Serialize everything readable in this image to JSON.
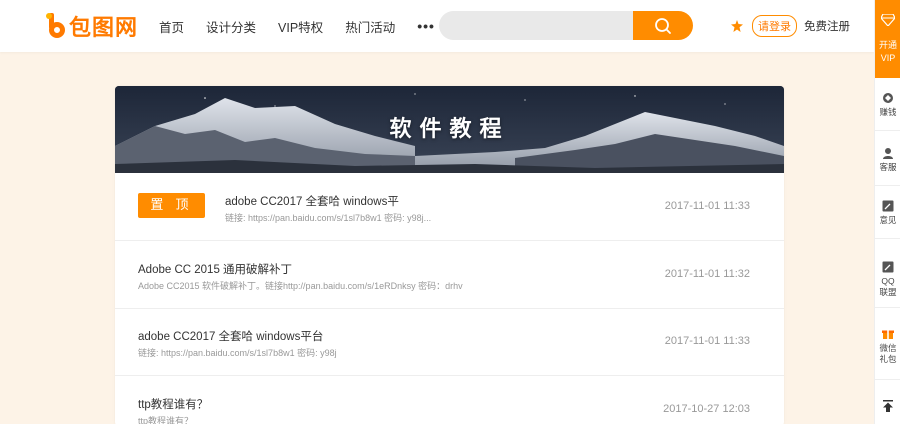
{
  "header": {
    "logo_text": "包图网",
    "nav": [
      "首页",
      "设计分类",
      "VIP特权",
      "热门活动"
    ],
    "nav_more": "•••",
    "search_placeholder": "",
    "login_label": "请登录",
    "register_label": "免费注册"
  },
  "sidebar": {
    "vip": [
      "开通",
      "VIP"
    ],
    "items": [
      {
        "icon": "ranking-icon",
        "label": [
          "赚钱"
        ]
      },
      {
        "icon": "customer-service-icon",
        "label": [
          "客服"
        ]
      },
      {
        "icon": "feedback-icon",
        "label": [
          "意见"
        ]
      },
      {
        "icon": "qq-alliance-icon",
        "label": [
          "QQ",
          "联盟"
        ]
      },
      {
        "icon": "gift-icon",
        "label": [
          "微信",
          "礼包"
        ]
      },
      {
        "icon": "back-to-top-icon",
        "label": []
      }
    ]
  },
  "banner_title": "软件教程",
  "pin_label": "置 顶",
  "articles": [
    {
      "title": "adobe CC2017 全套哈 windows平",
      "sub": "链接: https://pan.baidu.com/s/1sl7b8w1 密码: y98j...",
      "date": "2017-11-01 11:33",
      "pinned": true
    },
    {
      "title": "Adobe CC 2015 通用破解补丁",
      "sub": "Adobe CC2015 软件破解补丁。链接http://pan.baidu.com/s/1eRDnksy 密码：drhv",
      "date": "2017-11-01 11:32",
      "pinned": false
    },
    {
      "title": "adobe CC2017 全套哈 windows平台",
      "sub": "链接: https://pan.baidu.com/s/1sl7b8w1 密码: y98j",
      "date": "2017-11-01 11:33",
      "pinned": false
    },
    {
      "title": "ttp教程谁有？",
      "sub": "ttp教程谁有？",
      "date": "2017-10-27 12:03",
      "pinned": false
    }
  ],
  "colors": {
    "accent": "#ff8c00",
    "background": "#fdf3e7"
  }
}
